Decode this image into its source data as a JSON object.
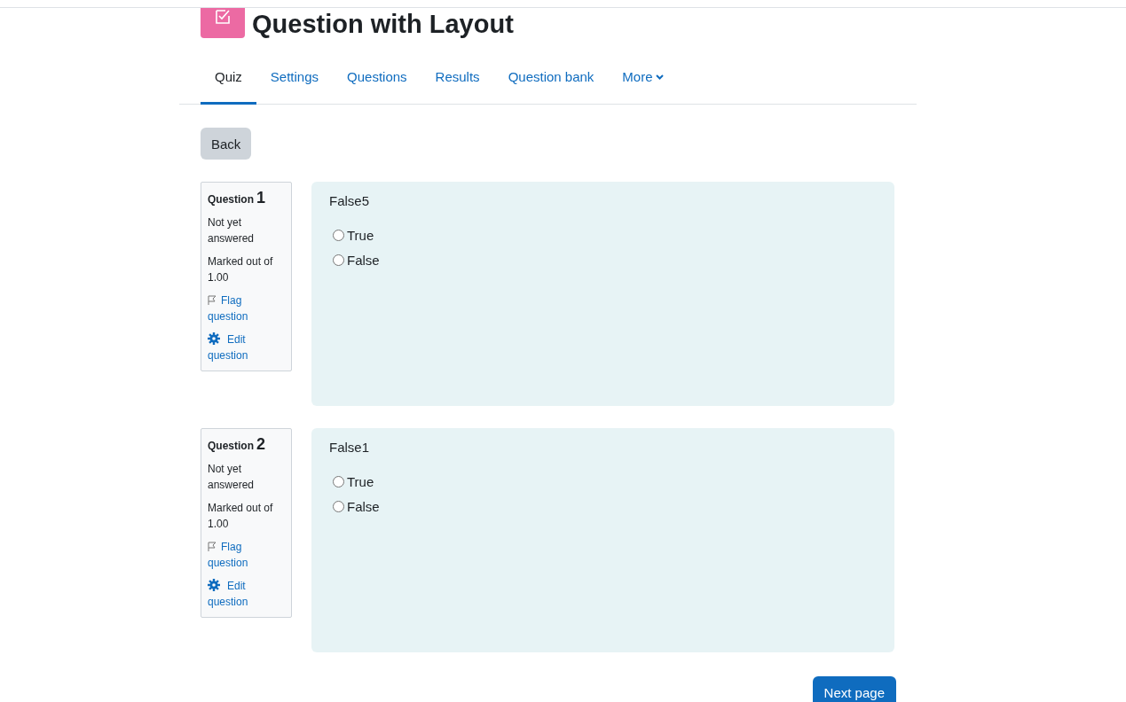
{
  "page_title": "Question with Layout",
  "tabs": [
    {
      "label": "Quiz",
      "selected": true
    },
    {
      "label": "Settings",
      "selected": false
    },
    {
      "label": "Questions",
      "selected": false
    },
    {
      "label": "Results",
      "selected": false
    },
    {
      "label": "Question bank",
      "selected": false
    },
    {
      "label": "More",
      "selected": false
    }
  ],
  "back_button": "Back",
  "questions": [
    {
      "label": "Question",
      "number": "1",
      "state": "Not yet answered",
      "marks": "Marked out of 1.00",
      "flag_link": "Flag question",
      "edit_link": "Edit question",
      "text": "False5",
      "options": [
        {
          "label": "True",
          "selected": false
        },
        {
          "label": "False",
          "selected": false
        }
      ]
    },
    {
      "label": "Question",
      "number": "2",
      "state": "Not yet answered",
      "marks": "Marked out of 1.00",
      "flag_link": "Flag question",
      "edit_link": "Edit question",
      "text": "False1",
      "options": [
        {
          "label": "True",
          "selected": false
        },
        {
          "label": "False",
          "selected": false
        }
      ]
    }
  ],
  "next_button": "Next page"
}
